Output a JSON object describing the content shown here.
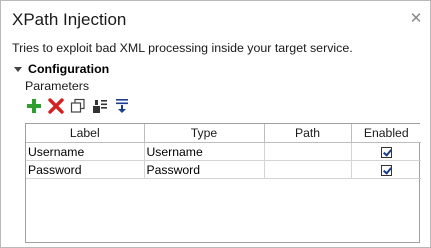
{
  "dialog": {
    "title": "XPath Injection",
    "description": "Tries to exploit bad XML processing inside your target service.",
    "close_icon": "close-icon"
  },
  "configuration": {
    "section_label": "Configuration",
    "parameters_label": "Parameters",
    "toolbar": [
      {
        "name": "add-icon",
        "color": "#2e9e2e"
      },
      {
        "name": "delete-icon",
        "color": "#d42020"
      },
      {
        "name": "copy-icon",
        "color": "#444444"
      },
      {
        "name": "move-up-icon",
        "color": "#333333"
      },
      {
        "name": "move-down-icon",
        "color": "#1a3d8f"
      }
    ]
  },
  "table": {
    "columns": [
      "Label",
      "Type",
      "Path",
      "Enabled"
    ],
    "rows": [
      {
        "label": "Username",
        "type": "Username",
        "path": "",
        "enabled": true
      },
      {
        "label": "Password",
        "type": "Password",
        "path": "",
        "enabled": true
      }
    ]
  }
}
